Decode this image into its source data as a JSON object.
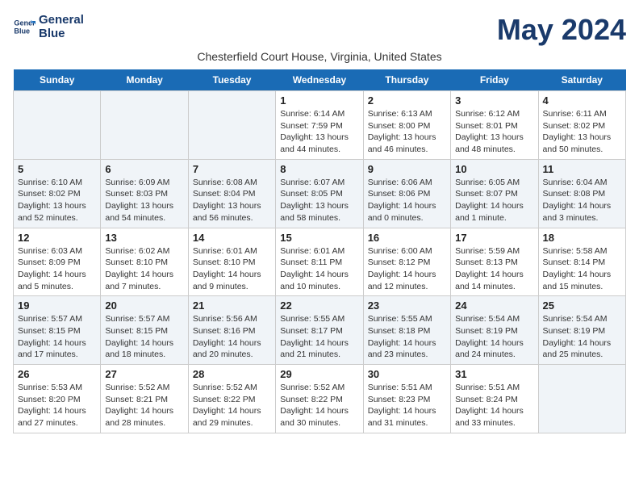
{
  "header": {
    "logo_line1": "General",
    "logo_line2": "Blue",
    "title": "May 2024",
    "subtitle": "Chesterfield Court House, Virginia, United States"
  },
  "days_of_week": [
    "Sunday",
    "Monday",
    "Tuesday",
    "Wednesday",
    "Thursday",
    "Friday",
    "Saturday"
  ],
  "weeks": [
    {
      "days": [
        {
          "num": "",
          "empty": true
        },
        {
          "num": "",
          "empty": true
        },
        {
          "num": "",
          "empty": true
        },
        {
          "num": "1",
          "sunrise": "6:14 AM",
          "sunset": "7:59 PM",
          "daylight": "13 hours and 44 minutes."
        },
        {
          "num": "2",
          "sunrise": "6:13 AM",
          "sunset": "8:00 PM",
          "daylight": "13 hours and 46 minutes."
        },
        {
          "num": "3",
          "sunrise": "6:12 AM",
          "sunset": "8:01 PM",
          "daylight": "13 hours and 48 minutes."
        },
        {
          "num": "4",
          "sunrise": "6:11 AM",
          "sunset": "8:02 PM",
          "daylight": "13 hours and 50 minutes."
        }
      ]
    },
    {
      "days": [
        {
          "num": "5",
          "sunrise": "6:10 AM",
          "sunset": "8:02 PM",
          "daylight": "13 hours and 52 minutes."
        },
        {
          "num": "6",
          "sunrise": "6:09 AM",
          "sunset": "8:03 PM",
          "daylight": "13 hours and 54 minutes."
        },
        {
          "num": "7",
          "sunrise": "6:08 AM",
          "sunset": "8:04 PM",
          "daylight": "13 hours and 56 minutes."
        },
        {
          "num": "8",
          "sunrise": "6:07 AM",
          "sunset": "8:05 PM",
          "daylight": "13 hours and 58 minutes."
        },
        {
          "num": "9",
          "sunrise": "6:06 AM",
          "sunset": "8:06 PM",
          "daylight": "14 hours and 0 minutes."
        },
        {
          "num": "10",
          "sunrise": "6:05 AM",
          "sunset": "8:07 PM",
          "daylight": "14 hours and 1 minute."
        },
        {
          "num": "11",
          "sunrise": "6:04 AM",
          "sunset": "8:08 PM",
          "daylight": "14 hours and 3 minutes."
        }
      ]
    },
    {
      "days": [
        {
          "num": "12",
          "sunrise": "6:03 AM",
          "sunset": "8:09 PM",
          "daylight": "14 hours and 5 minutes."
        },
        {
          "num": "13",
          "sunrise": "6:02 AM",
          "sunset": "8:10 PM",
          "daylight": "14 hours and 7 minutes."
        },
        {
          "num": "14",
          "sunrise": "6:01 AM",
          "sunset": "8:10 PM",
          "daylight": "14 hours and 9 minutes."
        },
        {
          "num": "15",
          "sunrise": "6:01 AM",
          "sunset": "8:11 PM",
          "daylight": "14 hours and 10 minutes."
        },
        {
          "num": "16",
          "sunrise": "6:00 AM",
          "sunset": "8:12 PM",
          "daylight": "14 hours and 12 minutes."
        },
        {
          "num": "17",
          "sunrise": "5:59 AM",
          "sunset": "8:13 PM",
          "daylight": "14 hours and 14 minutes."
        },
        {
          "num": "18",
          "sunrise": "5:58 AM",
          "sunset": "8:14 PM",
          "daylight": "14 hours and 15 minutes."
        }
      ]
    },
    {
      "days": [
        {
          "num": "19",
          "sunrise": "5:57 AM",
          "sunset": "8:15 PM",
          "daylight": "14 hours and 17 minutes."
        },
        {
          "num": "20",
          "sunrise": "5:57 AM",
          "sunset": "8:15 PM",
          "daylight": "14 hours and 18 minutes."
        },
        {
          "num": "21",
          "sunrise": "5:56 AM",
          "sunset": "8:16 PM",
          "daylight": "14 hours and 20 minutes."
        },
        {
          "num": "22",
          "sunrise": "5:55 AM",
          "sunset": "8:17 PM",
          "daylight": "14 hours and 21 minutes."
        },
        {
          "num": "23",
          "sunrise": "5:55 AM",
          "sunset": "8:18 PM",
          "daylight": "14 hours and 23 minutes."
        },
        {
          "num": "24",
          "sunrise": "5:54 AM",
          "sunset": "8:19 PM",
          "daylight": "14 hours and 24 minutes."
        },
        {
          "num": "25",
          "sunrise": "5:54 AM",
          "sunset": "8:19 PM",
          "daylight": "14 hours and 25 minutes."
        }
      ]
    },
    {
      "days": [
        {
          "num": "26",
          "sunrise": "5:53 AM",
          "sunset": "8:20 PM",
          "daylight": "14 hours and 27 minutes."
        },
        {
          "num": "27",
          "sunrise": "5:52 AM",
          "sunset": "8:21 PM",
          "daylight": "14 hours and 28 minutes."
        },
        {
          "num": "28",
          "sunrise": "5:52 AM",
          "sunset": "8:22 PM",
          "daylight": "14 hours and 29 minutes."
        },
        {
          "num": "29",
          "sunrise": "5:52 AM",
          "sunset": "8:22 PM",
          "daylight": "14 hours and 30 minutes."
        },
        {
          "num": "30",
          "sunrise": "5:51 AM",
          "sunset": "8:23 PM",
          "daylight": "14 hours and 31 minutes."
        },
        {
          "num": "31",
          "sunrise": "5:51 AM",
          "sunset": "8:24 PM",
          "daylight": "14 hours and 33 minutes."
        },
        {
          "num": "",
          "empty": true
        }
      ]
    }
  ],
  "labels": {
    "sunrise": "Sunrise:",
    "sunset": "Sunset:",
    "daylight": "Daylight:"
  }
}
